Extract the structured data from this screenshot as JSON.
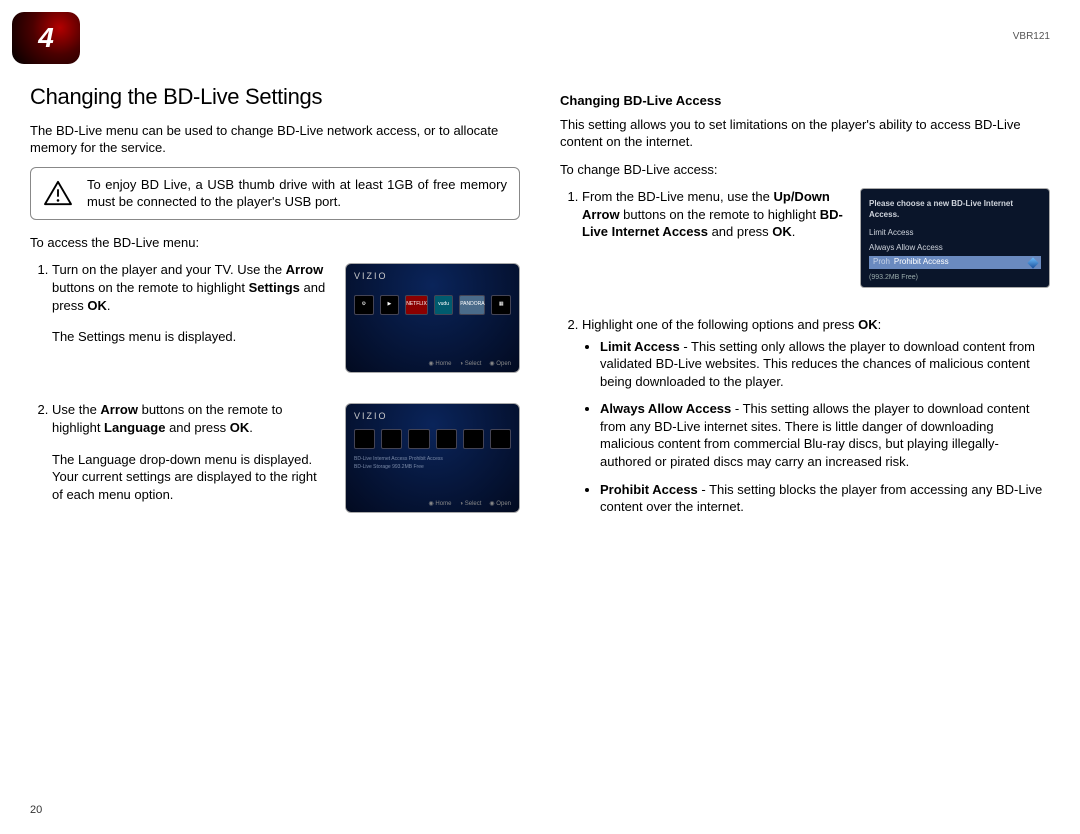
{
  "chapter_number": "4",
  "model_code": "VBR121",
  "page_number": "20",
  "left": {
    "title": "Changing the BD-Live Settings",
    "intro": "The BD-Live menu can be used to change BD-Live network access, or to allocate memory for the service.",
    "warning": "To enjoy BD Live, a USB thumb drive with at least 1GB of free memory must be connected to the player's USB port.",
    "access_lead": "To access the BD-Live menu:",
    "step1_a": "Turn on the player and your TV. Use the ",
    "step1_b": " buttons on the remote to highlight ",
    "step1_c": " and press ",
    "kw_arrow": "Arrow",
    "kw_settings": "Settings",
    "kw_ok": "OK",
    "step1_end": ".",
    "step1_after": "The Settings menu is displayed.",
    "step2_a": "Use the ",
    "step2_b": " buttons on the remote to highlight ",
    "kw_language": "Language",
    "step2_c": " and press ",
    "step2_end": ".",
    "step2_after": "The Language drop-down menu is displayed. Your current settings are displayed to the right of each menu option.",
    "panel1": {
      "logo": "VIZIO",
      "iconlabels": [
        "⚙",
        "▶",
        "NETFLIX",
        "vudu",
        "PANDORA",
        "▦"
      ],
      "footer": [
        "◉ Home",
        "◑ Select",
        "◉ Open"
      ]
    },
    "panel2": {
      "logo": "VIZIO",
      "footer": [
        "◉ Home",
        "◑ Select",
        "◉ Open"
      ],
      "lines": [
        "BD-Live Internet Access   Prohibit Access",
        "BD-Live Storage   993.2MB Free"
      ]
    }
  },
  "right": {
    "subheading": "Changing BD-Live Access",
    "intro": "This setting allows you to set limitations on the player's ability to access BD-Live content on the internet.",
    "lead": "To change BD-Live access:",
    "step1_a": "From the BD-Live menu, use the ",
    "kw_updown": "Up/Down Arrow",
    "step1_b": " buttons on the remote to highlight ",
    "kw_bdlive_access": "BD-Live Internet Access",
    "step1_c": " and press ",
    "kw_ok": "OK",
    "step1_end": ".",
    "step2": "Highlight one of the following options and press ",
    "step2_end": ":",
    "options": {
      "limit_label": "Limit Access",
      "limit_text": " - This setting only allows the player to download content from validated BD-Live websites. This reduces the chances of malicious content being downloaded to the player.",
      "always_label": "Always Allow Access",
      "always_text": " - This setting allows the player to download content from any BD-Live internet sites. There is little danger of downloading malicious content from commercial Blu-ray discs, but playing illegally-authored or pirated discs may carry an increased risk.",
      "prohibit_label": "Prohibit Access",
      "prohibit_text": " - This setting blocks the player from accessing any BD-Live content over the internet."
    },
    "popup": {
      "title": "Please choose a new BD-Live Internet Access.",
      "opt_limit": "Limit Access",
      "opt_always": "Always Allow Access",
      "opt_prohibit_prefix": "Proh",
      "opt_prohibit": "Prohibit Access",
      "free": "(993.2MB Free)"
    }
  }
}
